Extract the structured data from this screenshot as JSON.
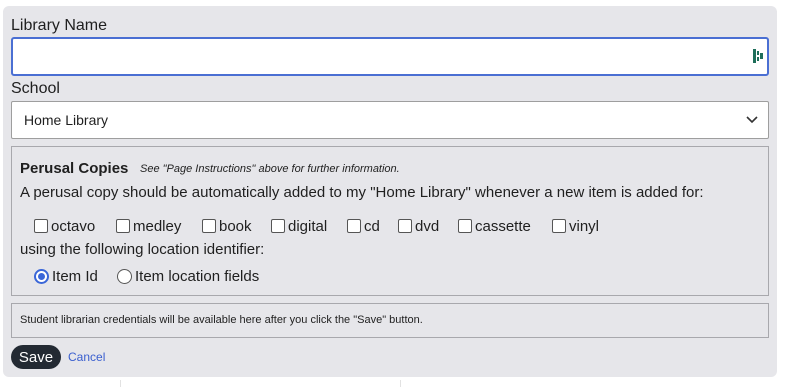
{
  "form": {
    "library_name_label": "Library Name",
    "library_name_value": "",
    "school_label": "School",
    "school_selected": "Home Library"
  },
  "perusal": {
    "title": "Perusal Copies",
    "hint": "See \"Page Instructions\" above for further information.",
    "description": "A perusal copy should be automatically added to my \"Home Library\" whenever a new item is added for:",
    "formats": [
      {
        "label": "octavo",
        "checked": false
      },
      {
        "label": "medley",
        "checked": false
      },
      {
        "label": "book",
        "checked": false
      },
      {
        "label": "digital",
        "checked": false
      },
      {
        "label": "cd",
        "checked": false
      },
      {
        "label": "dvd",
        "checked": false
      },
      {
        "label": "cassette",
        "checked": false
      },
      {
        "label": "vinyl",
        "checked": false
      }
    ],
    "location_description": "using the following location identifier:",
    "location_options": [
      {
        "label": "Item Id",
        "selected": true
      },
      {
        "label": "Item location fields",
        "selected": false
      }
    ]
  },
  "info": {
    "text": "Student librarian credentials will be available here after you click the \"Save\" button."
  },
  "actions": {
    "save_label": "Save",
    "cancel_label": "Cancel"
  },
  "colors": {
    "accent": "#3a66d8",
    "panel": "#e6e6ea",
    "save_button": "#232a33"
  },
  "icons": {
    "password_manager": "password-manager-icon",
    "dropdown": "chevron-down-icon"
  }
}
